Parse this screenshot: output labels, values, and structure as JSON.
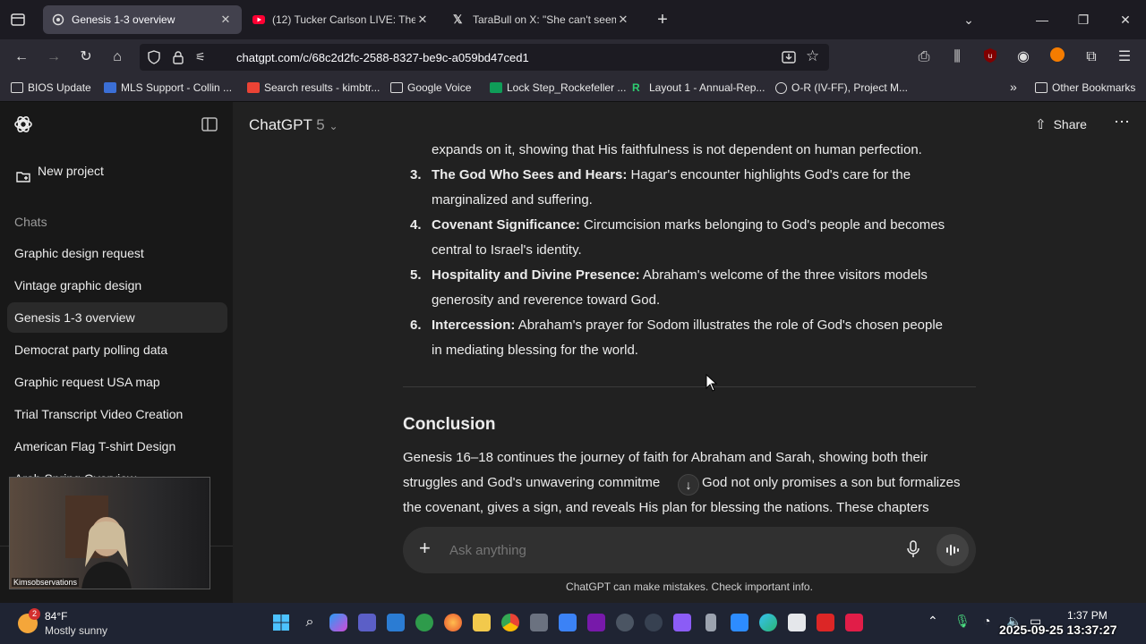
{
  "tabs": [
    {
      "label": "Genesis 1-3 overview",
      "active": true
    },
    {
      "label": "(12) Tucker Carlson LIVE: The Er",
      "active": false
    },
    {
      "label": "TaraBull on X: \"She can't seem t",
      "active": false
    }
  ],
  "nav": {
    "url": "chatgpt.com/c/68c2d2fc-2588-8327-be9c-a059bd47ced1"
  },
  "bookmarks": [
    "BIOS Update",
    "MLS Support - Collin ...",
    "Search results - kimbtr...",
    "Google Voice",
    "Lock Step_Rockefeller ...",
    "Layout 1 - Annual-Rep...",
    "O-R (IV-FF), Project M...",
    "Other Bookmarks"
  ],
  "sidebar": {
    "new_project": "New project",
    "chats_heading": "Chats",
    "chats": [
      "Graphic design request",
      "Vintage graphic design",
      "Genesis 1-3 overview",
      "Democrat party polling data",
      "Graphic request USA map",
      "Trial Transcript Video Creation",
      "American Flag T-shirt Design",
      "Arab Spring Overview"
    ]
  },
  "header": {
    "model": "ChatGPT",
    "version": "5",
    "share": "Share"
  },
  "content": {
    "partial_line": "expands on it, showing that His faithfulness is not dependent on human perfection.",
    "items": [
      {
        "num": "3.",
        "title": "The God Who Sees and Hears:",
        "line1": "Hagar's encounter highlights God's care for the",
        "line2": "marginalized and suffering."
      },
      {
        "num": "4.",
        "title": "Covenant Significance:",
        "line1": "Circumcision marks belonging to God's people and becomes",
        "line2": "central to Israel's identity."
      },
      {
        "num": "5.",
        "title": "Hospitality and Divine Presence:",
        "line1": "Abraham's welcome of the three visitors models",
        "line2": "generosity and reverence toward God."
      },
      {
        "num": "6.",
        "title": "Intercession:",
        "line1": "Abraham's prayer for Sodom illustrates the role of God's chosen people",
        "line2": "in mediating blessing for the world."
      }
    ],
    "conclusion_heading": "Conclusion",
    "conclusion_lines": [
      "Genesis 16–18 continues the journey of faith for Abraham and Sarah, showing both their",
      "struggles and God's unwavering commitme",
      "God not only promises a son but formalizes",
      "the covenant, gives a sign, and reveals His plan for blessing the nations. These chapters"
    ]
  },
  "composer": {
    "placeholder": "Ask anything"
  },
  "footer": {
    "disclaimer": "ChatGPT can make mistakes. Check important info."
  },
  "webcam": {
    "label": "Kimsobservations"
  },
  "taskbar": {
    "weather_temp": "84°F",
    "weather_desc": "Mostly sunny",
    "weather_badge": "2",
    "time": "1:37 PM",
    "datetime_stamp": "2025-09-25 13:37:27"
  }
}
